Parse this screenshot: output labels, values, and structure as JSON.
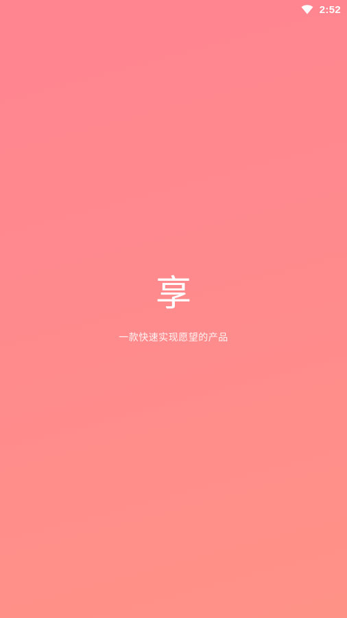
{
  "status_bar": {
    "time": "2:52",
    "wifi_icon": "wifi-icon"
  },
  "splash": {
    "logo_text": "享",
    "tagline": "一款快速实现愿望的产品"
  },
  "colors": {
    "background_start": "#ff8591",
    "background_end": "#ff9287",
    "text": "#ffffff"
  }
}
